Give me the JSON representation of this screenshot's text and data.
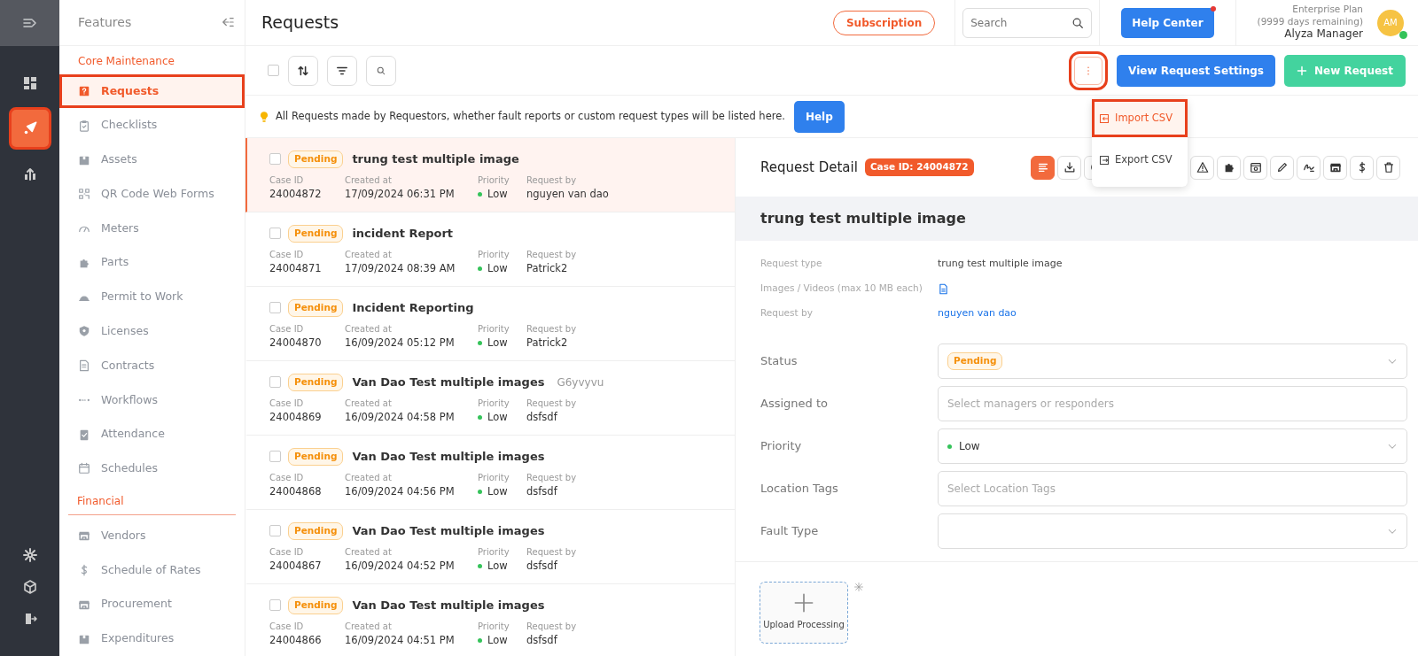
{
  "rail": {
    "top": [
      {
        "kind": "dashboard",
        "selected": false,
        "highlighted": false
      },
      {
        "kind": "rocket",
        "selected": true,
        "highlighted": true
      },
      {
        "kind": "chart",
        "selected": false,
        "highlighted": false
      }
    ],
    "bottom": [
      {
        "kind": "gear"
      },
      {
        "kind": "cube"
      },
      {
        "kind": "exit"
      }
    ]
  },
  "sidebar": {
    "title": "Features",
    "sections": [
      {
        "title": "Core Maintenance",
        "items": [
          {
            "label": "Requests",
            "kind": "question",
            "selected": true,
            "highlighted": true
          },
          {
            "label": "Checklists",
            "kind": "clipboard",
            "selected": false,
            "highlighted": false
          },
          {
            "label": "Assets",
            "kind": "box",
            "selected": false,
            "highlighted": false
          },
          {
            "label": "QR Code Web Forms",
            "kind": "qr",
            "selected": false,
            "highlighted": false
          },
          {
            "label": "Meters",
            "kind": "gauge",
            "selected": false,
            "highlighted": false
          },
          {
            "label": "Parts",
            "kind": "puzzle",
            "selected": false,
            "highlighted": false
          },
          {
            "label": "Permit to Work",
            "kind": "helmet",
            "selected": false,
            "highlighted": false
          },
          {
            "label": "Licenses",
            "kind": "shield",
            "selected": false,
            "highlighted": false
          },
          {
            "label": "Contracts",
            "kind": "doc",
            "selected": false,
            "highlighted": false
          },
          {
            "label": "Workflows",
            "kind": "dots",
            "selected": false,
            "highlighted": false
          },
          {
            "label": "Attendance",
            "kind": "check",
            "selected": false,
            "highlighted": false
          },
          {
            "label": "Schedules",
            "kind": "calendar",
            "selected": false,
            "highlighted": false
          }
        ]
      },
      {
        "title": "Financial",
        "items": [
          {
            "label": "Vendors",
            "kind": "store",
            "selected": false,
            "highlighted": false
          },
          {
            "label": "Schedule of Rates",
            "kind": "dollar",
            "selected": false,
            "highlighted": false
          },
          {
            "label": "Procurement",
            "kind": "store",
            "selected": false,
            "highlighted": false
          },
          {
            "label": "Expenditures",
            "kind": "box",
            "selected": false,
            "highlighted": false
          }
        ]
      }
    ]
  },
  "header": {
    "title": "Requests",
    "subscription": "Subscription",
    "search": {
      "placeholder": "Search"
    },
    "help_center": "Help Center",
    "plan": "Enterprise Plan",
    "days": "(9999 days remaining)",
    "user": "Alyza Manager",
    "avatar": "AM"
  },
  "toolbar": {
    "select_all_checked": false,
    "more_highlighted": true,
    "view_settings": "View Request Settings",
    "new_request": "New Request"
  },
  "menu": [
    {
      "label": "Import CSV",
      "kind": "import",
      "highlighted": true
    },
    {
      "label": "Export CSV",
      "kind": "export",
      "highlighted": false
    }
  ],
  "notice": {
    "text": "All Requests made by Requestors, whether fault reports or custom request types will be listed here.",
    "button": "Help"
  },
  "requests": [
    {
      "selected": true,
      "checked": false,
      "status": "Pending",
      "title": "trung test multiple image",
      "fields": [
        {
          "label": "Case ID",
          "value": "24004872",
          "kind": "text"
        },
        {
          "label": "Created at",
          "value": "17/09/2024 06:31 PM",
          "kind": "text"
        },
        {
          "label": "Priority",
          "value": "Low",
          "kind": "priority"
        },
        {
          "label": "Request by",
          "value": "nguyen van dao",
          "kind": "text"
        }
      ]
    },
    {
      "selected": false,
      "checked": false,
      "status": "Pending",
      "title": "incident Report",
      "fields": [
        {
          "label": "Case ID",
          "value": "24004871",
          "kind": "text"
        },
        {
          "label": "Created at",
          "value": "17/09/2024 08:39 AM",
          "kind": "text"
        },
        {
          "label": "Priority",
          "value": "Low",
          "kind": "priority"
        },
        {
          "label": "Request by",
          "value": "Patrick2",
          "kind": "text"
        }
      ]
    },
    {
      "selected": false,
      "checked": false,
      "status": "Pending",
      "title": "Incident Reporting",
      "fields": [
        {
          "label": "Case ID",
          "value": "24004870",
          "kind": "text"
        },
        {
          "label": "Created at",
          "value": "16/09/2024 05:12 PM",
          "kind": "text"
        },
        {
          "label": "Priority",
          "value": "Low",
          "kind": "priority"
        },
        {
          "label": "Request by",
          "value": "Patrick2",
          "kind": "text"
        }
      ]
    },
    {
      "selected": false,
      "checked": false,
      "status": "Pending",
      "title": "Van Dao Test multiple images",
      "extra": "G6yvyvu",
      "fields": [
        {
          "label": "Case ID",
          "value": "24004869",
          "kind": "text"
        },
        {
          "label": "Created at",
          "value": "16/09/2024 04:58 PM",
          "kind": "text"
        },
        {
          "label": "Priority",
          "value": "Low",
          "kind": "priority"
        },
        {
          "label": "Request by",
          "value": "dsfsdf",
          "kind": "text"
        }
      ]
    },
    {
      "selected": false,
      "checked": false,
      "status": "Pending",
      "title": "Van Dao Test multiple images",
      "fields": [
        {
          "label": "Case ID",
          "value": "24004868",
          "kind": "text"
        },
        {
          "label": "Created at",
          "value": "16/09/2024 04:56 PM",
          "kind": "text"
        },
        {
          "label": "Priority",
          "value": "Low",
          "kind": "priority"
        },
        {
          "label": "Request by",
          "value": "dsfsdf",
          "kind": "text"
        }
      ]
    },
    {
      "selected": false,
      "checked": false,
      "status": "Pending",
      "title": "Van Dao Test multiple images",
      "fields": [
        {
          "label": "Case ID",
          "value": "24004867",
          "kind": "text"
        },
        {
          "label": "Created at",
          "value": "16/09/2024 04:52 PM",
          "kind": "text"
        },
        {
          "label": "Priority",
          "value": "Low",
          "kind": "priority"
        },
        {
          "label": "Request by",
          "value": "dsfsdf",
          "kind": "text"
        }
      ]
    },
    {
      "selected": false,
      "checked": false,
      "status": "Pending",
      "title": "Van Dao Test multiple images",
      "fields": [
        {
          "label": "Case ID",
          "value": "24004866",
          "kind": "text"
        },
        {
          "label": "Created at",
          "value": "16/09/2024 04:51 PM",
          "kind": "text"
        },
        {
          "label": "Priority",
          "value": "Low",
          "kind": "priority"
        },
        {
          "label": "Request by",
          "value": "dsfsdf",
          "kind": "text"
        }
      ]
    }
  ],
  "detail": {
    "heading": "Request Detail",
    "case_badge": "Case ID: 24004872",
    "tools": [
      {
        "kind": "lines",
        "selected": true
      },
      {
        "kind": "download",
        "selected": false
      },
      {
        "kind": "clock"
      },
      {
        "kind": "hidden"
      },
      {
        "kind": "hidden"
      },
      {
        "kind": "hidden"
      },
      {
        "kind": "warning",
        "selected": false
      },
      {
        "kind": "puzzle",
        "selected": false
      },
      {
        "kind": "frame",
        "selected": false
      },
      {
        "kind": "pencil",
        "selected": false
      },
      {
        "kind": "signature",
        "selected": false
      },
      {
        "kind": "store",
        "selected": false
      },
      {
        "kind": "dollar",
        "selected": false
      },
      {
        "kind": "trash",
        "selected": false
      }
    ],
    "title": "trung test multiple image",
    "info": [
      {
        "label": "Request type",
        "value": "trung test multiple image",
        "kind": "text"
      },
      {
        "label": "Images / Videos (max 10 MB each)",
        "kind": "file"
      },
      {
        "label": "Request by",
        "value": "nguyen van dao",
        "kind": "link"
      }
    ],
    "form": [
      {
        "label": "Status",
        "kind": "select",
        "badge": "Pending"
      },
      {
        "label": "Assigned to",
        "kind": "input",
        "placeholder": "Select managers or responders"
      },
      {
        "label": "Priority",
        "kind": "select",
        "value": "Low"
      },
      {
        "label": "Location Tags",
        "kind": "input",
        "placeholder": "Select Location Tags"
      },
      {
        "label": "Fault Type",
        "kind": "select"
      }
    ],
    "upload": "Upload Processing"
  }
}
